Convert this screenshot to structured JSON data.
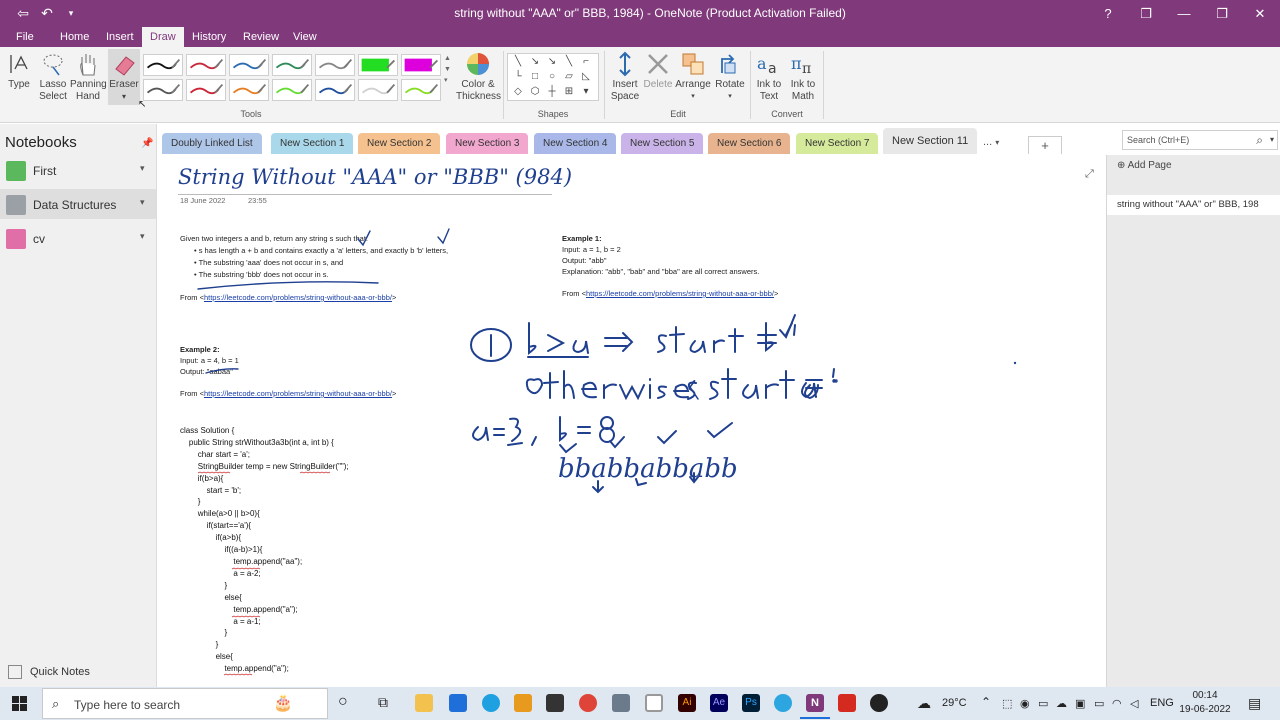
{
  "window": {
    "title": "string without \"AAA\" or\" BBB, 1984) - OneNote (Product Activation Failed)",
    "controls": [
      "?",
      "❐",
      "—",
      "❐",
      "✕"
    ]
  },
  "menu": {
    "tabs": [
      "File",
      "Home",
      "Insert",
      "Draw",
      "History",
      "Review",
      "View"
    ],
    "active": "Draw"
  },
  "ribbon": {
    "type": "Type",
    "lasso": "Lasso Select",
    "panning": "Panning Hand",
    "eraser": "Eraser",
    "color_thickness": "Color & Thickness",
    "insert_space": "Insert Space",
    "delete": "Delete",
    "arrange": "Arrange",
    "rotate": "Rotate",
    "ink_to_text": "Ink to Text",
    "ink_to_math": "Ink to Math",
    "groups": {
      "tools": "Tools",
      "shapes": "Shapes",
      "edit": "Edit",
      "convert": "Convert"
    },
    "pen_colors": [
      "#111111",
      "#c8283c",
      "#2b6cb0",
      "#2e8b57",
      "#888888",
      "#22dd22",
      "#dd00dd",
      "#555555",
      "#cc2233",
      "#e67e22",
      "#66dd33",
      "#1f4e9c",
      "#d0d0d0",
      "#88dd22"
    ]
  },
  "notebooks": {
    "header": "Notebooks",
    "items": [
      {
        "label": "First",
        "color": "#5cb85c"
      },
      {
        "label": "Data Structures",
        "color": "#9aa0a6"
      },
      {
        "label": "cv",
        "color": "#e06fa8"
      }
    ],
    "quick_notes": "Quick Notes"
  },
  "sections": [
    {
      "label": "Doubly Linked List",
      "color": "#aec6e8"
    },
    {
      "label": "New Section 1",
      "color": "#a8d8ea"
    },
    {
      "label": "New Section 2",
      "color": "#f5c28f"
    },
    {
      "label": "New Section 3",
      "color": "#f2a7cf"
    },
    {
      "label": "New Section 4",
      "color": "#a9b8e8"
    },
    {
      "label": "New Section 5",
      "color": "#c9b3e8"
    },
    {
      "label": "New Section 6",
      "color": "#e8b48f"
    },
    {
      "label": "New Section 7",
      "color": "#d6ea9c"
    },
    {
      "label": "New Section 11",
      "color": "#e8e8e8"
    }
  ],
  "section_more": "...",
  "section_add": "+",
  "search_placeholder": "Search (Ctrl+E)",
  "pages": {
    "add_page": "Add Page",
    "entries": [
      "string without \"AAA\" or\" BBB, 198"
    ]
  },
  "page": {
    "title": "String Without \"AAA\" or \"BBB\" (984)",
    "date": "18 June 2022",
    "time": "23:55",
    "problem": {
      "intro": "Given two integers a and b, return any string s such that:",
      "bullets": [
        "s has length a + b and contains exactly a 'a' letters, and exactly b 'b' letters,",
        "The substring 'aaa' does not occur in s, and",
        "The substring 'bbb' does not occur in s."
      ]
    },
    "from_label": "From <",
    "from_end": ">",
    "link": "https://leetcode.com/problems/string-without-aaa-or-bbb/",
    "example1": {
      "title": "Example 1:",
      "input": "Input: a = 1, b = 2",
      "output": "Output: \"abb\"",
      "explanation": "Explanation: \"abb\", \"bab\" and \"bba\" are all correct answers."
    },
    "example2": {
      "title": "Example 2:",
      "input": "Input: a = 4, b = 1",
      "output": "Output: \"aabaa\""
    },
    "code": "class Solution {\n    public String strWithout3a3b(int a, int b) {\n        char start = 'a';\n        StringBuilder temp = new StringBuilder(\"\");\n        if(b>a){\n            start = 'b';\n        }\n        while(a>0 || b>0){\n            if(start=='a'){\n                if(a>b){\n                    if((a-b)>1){\n                        temp.append(\"aa\");\n                        a = a-2;\n                    }\n                    else{\n                        temp.append(\"a\");\n                        a = a-1;\n                    }\n                }\n                else{\n                    temp.append(\"a\");"
  },
  "taskbar": {
    "search_placeholder": "Type here to search",
    "temperature": "29°C",
    "language": "ENG",
    "time": "00:14",
    "date": "19-06-2022"
  }
}
